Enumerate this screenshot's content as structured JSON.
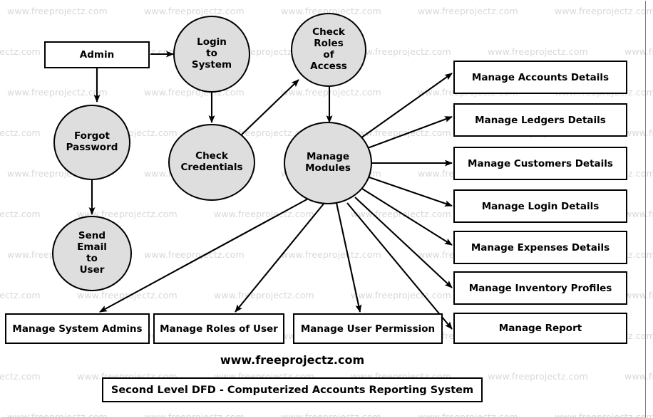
{
  "diagram": {
    "title": "Second Level DFD - Computerized Accounts Reporting System",
    "site_label": "www.freeprojectz.com",
    "watermark_text": "www.freeprojectz.com",
    "colors": {
      "process_fill": "#dedede",
      "stroke": "#000000",
      "entity_fill": "#ffffff",
      "watermark": "#d8d8d8",
      "background": "#ffffff"
    },
    "entities": [
      {
        "id": "admin",
        "label": "Admin"
      }
    ],
    "processes": [
      {
        "id": "login-to-system",
        "lines": [
          "Login",
          "to",
          "System"
        ]
      },
      {
        "id": "check-roles-of-access",
        "lines": [
          "Check",
          "Roles",
          "of",
          "Access"
        ]
      },
      {
        "id": "forgot-password",
        "lines": [
          "Forgot",
          "Password"
        ]
      },
      {
        "id": "check-credentials",
        "lines": [
          "Check",
          "Credentials"
        ]
      },
      {
        "id": "manage-modules",
        "lines": [
          "Manage",
          "Modules"
        ]
      },
      {
        "id": "send-email-to-user",
        "lines": [
          "Send",
          "Email",
          "to",
          "User"
        ]
      }
    ],
    "datastores_right": [
      {
        "id": "manage-accounts-details",
        "label": "Manage Accounts Details"
      },
      {
        "id": "manage-ledgers-details",
        "label": "Manage Ledgers Details"
      },
      {
        "id": "manage-customers-details",
        "label": "Manage Customers Details"
      },
      {
        "id": "manage-login-details",
        "label": "Manage Login Details"
      },
      {
        "id": "manage-expenses-details",
        "label": "Manage Expenses Details"
      },
      {
        "id": "manage-inventory-profiles",
        "label": "Manage Inventory Profiles"
      },
      {
        "id": "manage-report",
        "label": "Manage Report"
      }
    ],
    "datastores_bottom": [
      {
        "id": "manage-system-admins",
        "label": "Manage System Admins"
      },
      {
        "id": "manage-roles-of-user",
        "label": "Manage Roles of User"
      },
      {
        "id": "manage-user-permission",
        "label": "Manage User Permission"
      }
    ],
    "flows": [
      {
        "from": "admin",
        "to": "login-to-system"
      },
      {
        "from": "admin",
        "to": "forgot-password"
      },
      {
        "from": "login-to-system",
        "to": "check-credentials"
      },
      {
        "from": "check-credentials",
        "to": "check-roles-of-access"
      },
      {
        "from": "check-roles-of-access",
        "to": "manage-modules"
      },
      {
        "from": "forgot-password",
        "to": "send-email-to-user"
      },
      {
        "from": "manage-modules",
        "to": "manage-accounts-details"
      },
      {
        "from": "manage-modules",
        "to": "manage-ledgers-details"
      },
      {
        "from": "manage-modules",
        "to": "manage-customers-details"
      },
      {
        "from": "manage-modules",
        "to": "manage-login-details"
      },
      {
        "from": "manage-modules",
        "to": "manage-expenses-details"
      },
      {
        "from": "manage-modules",
        "to": "manage-inventory-profiles"
      },
      {
        "from": "manage-modules",
        "to": "manage-report"
      },
      {
        "from": "manage-modules",
        "to": "manage-system-admins"
      },
      {
        "from": "manage-modules",
        "to": "manage-roles-of-user"
      },
      {
        "from": "manage-modules",
        "to": "manage-user-permission"
      }
    ]
  }
}
